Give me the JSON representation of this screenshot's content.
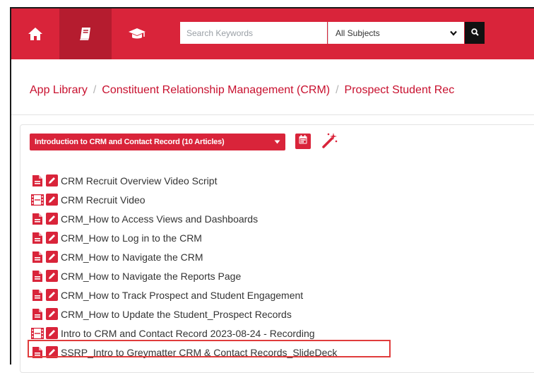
{
  "navbar": {
    "home_icon": "home-icon",
    "library_icon": "book-icon",
    "learning_icon": "graduation-cap-icon",
    "search": {
      "placeholder": "Search Keywords",
      "value": ""
    },
    "subject_select": {
      "selected": "All Subjects"
    },
    "search_icon": "search-icon",
    "color": "#d9243a"
  },
  "breadcrumb": [
    "App Library",
    "Constituent Relationship Management (CRM)",
    "Prospect Student Rec"
  ],
  "breadcrumb_separator": "/",
  "collection": {
    "label": "Introduction to CRM and Contact Record (10 Articles)",
    "calendar_icon": "calendar-icon",
    "wand_icon": "magic-wand-icon"
  },
  "articles": [
    {
      "title": "CRM Recruit Overview Video Script",
      "type_icon": "document-icon"
    },
    {
      "title": "CRM Recruit Video",
      "type_icon": "film-icon"
    },
    {
      "title": "CRM_How to Access Views and Dashboards",
      "type_icon": "document-icon"
    },
    {
      "title": "CRM_How to Log in to the CRM",
      "type_icon": "document-icon"
    },
    {
      "title": "CRM_How to Navigate the CRM",
      "type_icon": "document-icon"
    },
    {
      "title": "CRM_How to Navigate the Reports Page",
      "type_icon": "document-icon"
    },
    {
      "title": "CRM_How to Track Prospect and Student Engagement",
      "type_icon": "document-icon"
    },
    {
      "title": "CRM_How to Update the Student_Prospect Records",
      "type_icon": "document-icon"
    },
    {
      "title": "Intro to CRM and Contact Record 2023-08-24 - Recording",
      "type_icon": "film-icon"
    },
    {
      "title": "SSRP_Intro to Greymatter CRM & Contact Records_SlideDeck",
      "type_icon": "document-icon",
      "highlighted": true
    }
  ]
}
